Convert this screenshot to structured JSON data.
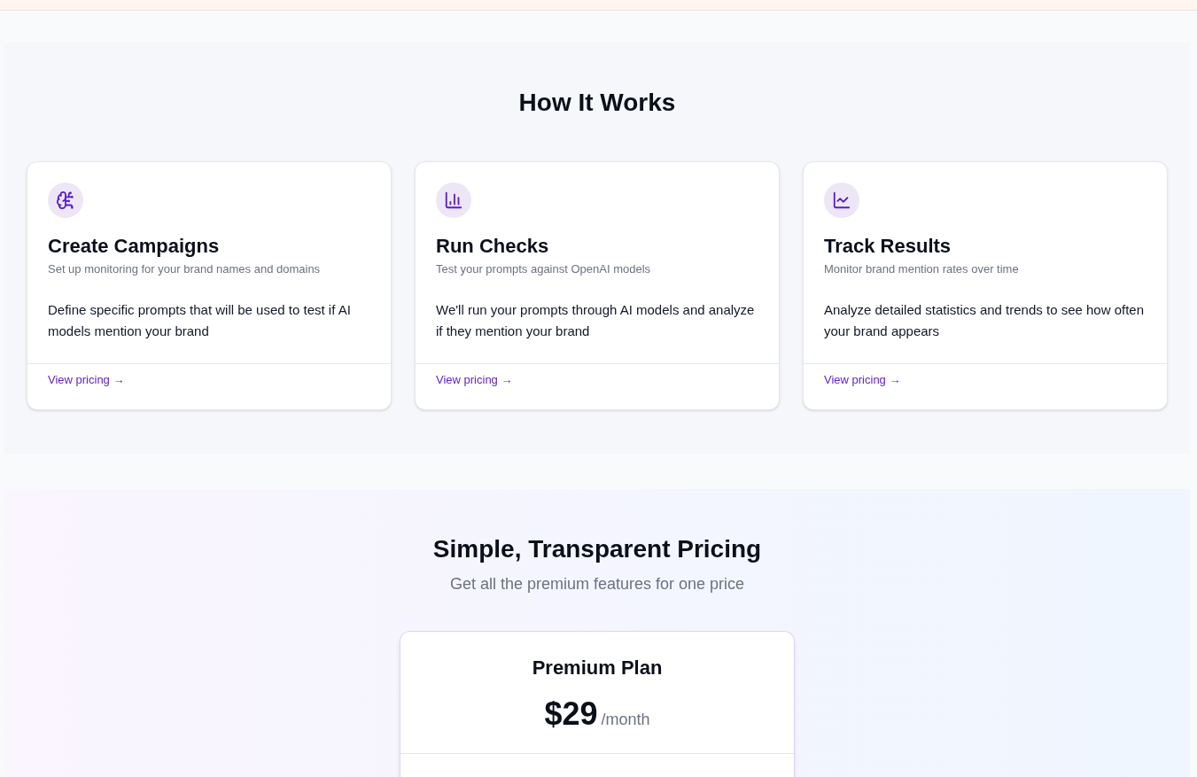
{
  "how_it_works": {
    "title": "How It Works",
    "steps": [
      {
        "title": "Create Campaigns",
        "subtitle": "Set up monitoring for your brand names and domains",
        "description": "Define specific prompts that will be used to test if AI models mention your brand",
        "link": "View pricing →"
      },
      {
        "title": "Run Checks",
        "subtitle": "Test your prompts against OpenAI models",
        "description": "We'll run your prompts through AI models and analyze if they mention your brand",
        "link": "View pricing →"
      },
      {
        "title": "Track Results",
        "subtitle": "Monitor brand mention rates over time",
        "description": "Analyze detailed statistics and trends to see how often your brand appears",
        "link": "View pricing →"
      }
    ]
  },
  "pricing": {
    "title": "Simple, Transparent Pricing",
    "subtitle": "Get all the premium features for one price",
    "plan": {
      "name": "Premium Plan",
      "price": "$29",
      "period": "/month"
    }
  }
}
